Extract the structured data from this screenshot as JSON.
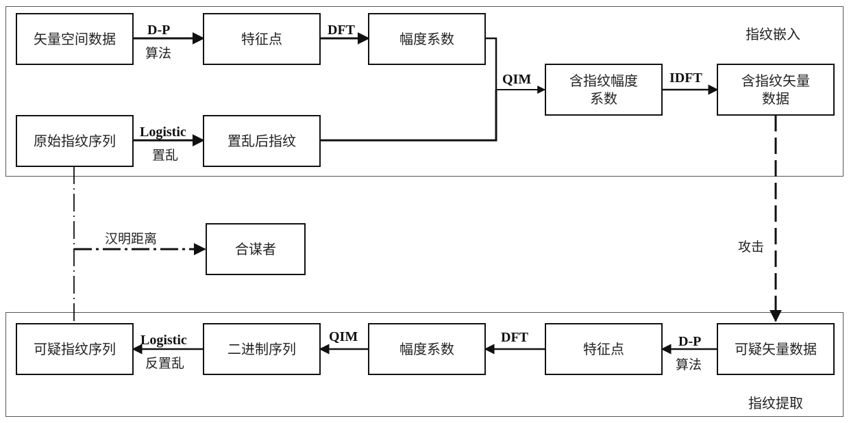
{
  "sections": {
    "embed_title": "指纹嵌入",
    "extract_title": "指纹提取"
  },
  "embed": {
    "nodes": {
      "vector_data": "矢量空间数据",
      "feature_points": "特征点",
      "amplitude_coeff": "幅度系数",
      "fp_amplitude_coeff": "含指纹幅度\n系数",
      "fp_vector_data": "含指纹矢量\n数据",
      "original_fp_seq": "原始指纹序列",
      "scrambled_fp": "置乱后指纹"
    },
    "edges": {
      "dp_top": "D-P",
      "dp_bottom": "算法",
      "dft": "DFT",
      "qim": "QIM",
      "idft": "IDFT",
      "logistic_top": "Logistic",
      "logistic_bottom": "置乱"
    }
  },
  "middle": {
    "colluder": "合谋者",
    "hamming_label": "汉明距离",
    "attack_label": "攻击"
  },
  "extract": {
    "nodes": {
      "suspect_fp_seq": "可疑指纹序列",
      "binary_seq": "二进制序列",
      "amplitude_coeff": "幅度系数",
      "feature_points": "特征点",
      "suspect_vector_data": "可疑矢量数据"
    },
    "edges": {
      "logistic_top": "Logistic",
      "logistic_bottom": "反置乱",
      "qim": "QIM",
      "dft": "DFT",
      "dp_top": "D-P",
      "dp_bottom": "算法"
    }
  }
}
